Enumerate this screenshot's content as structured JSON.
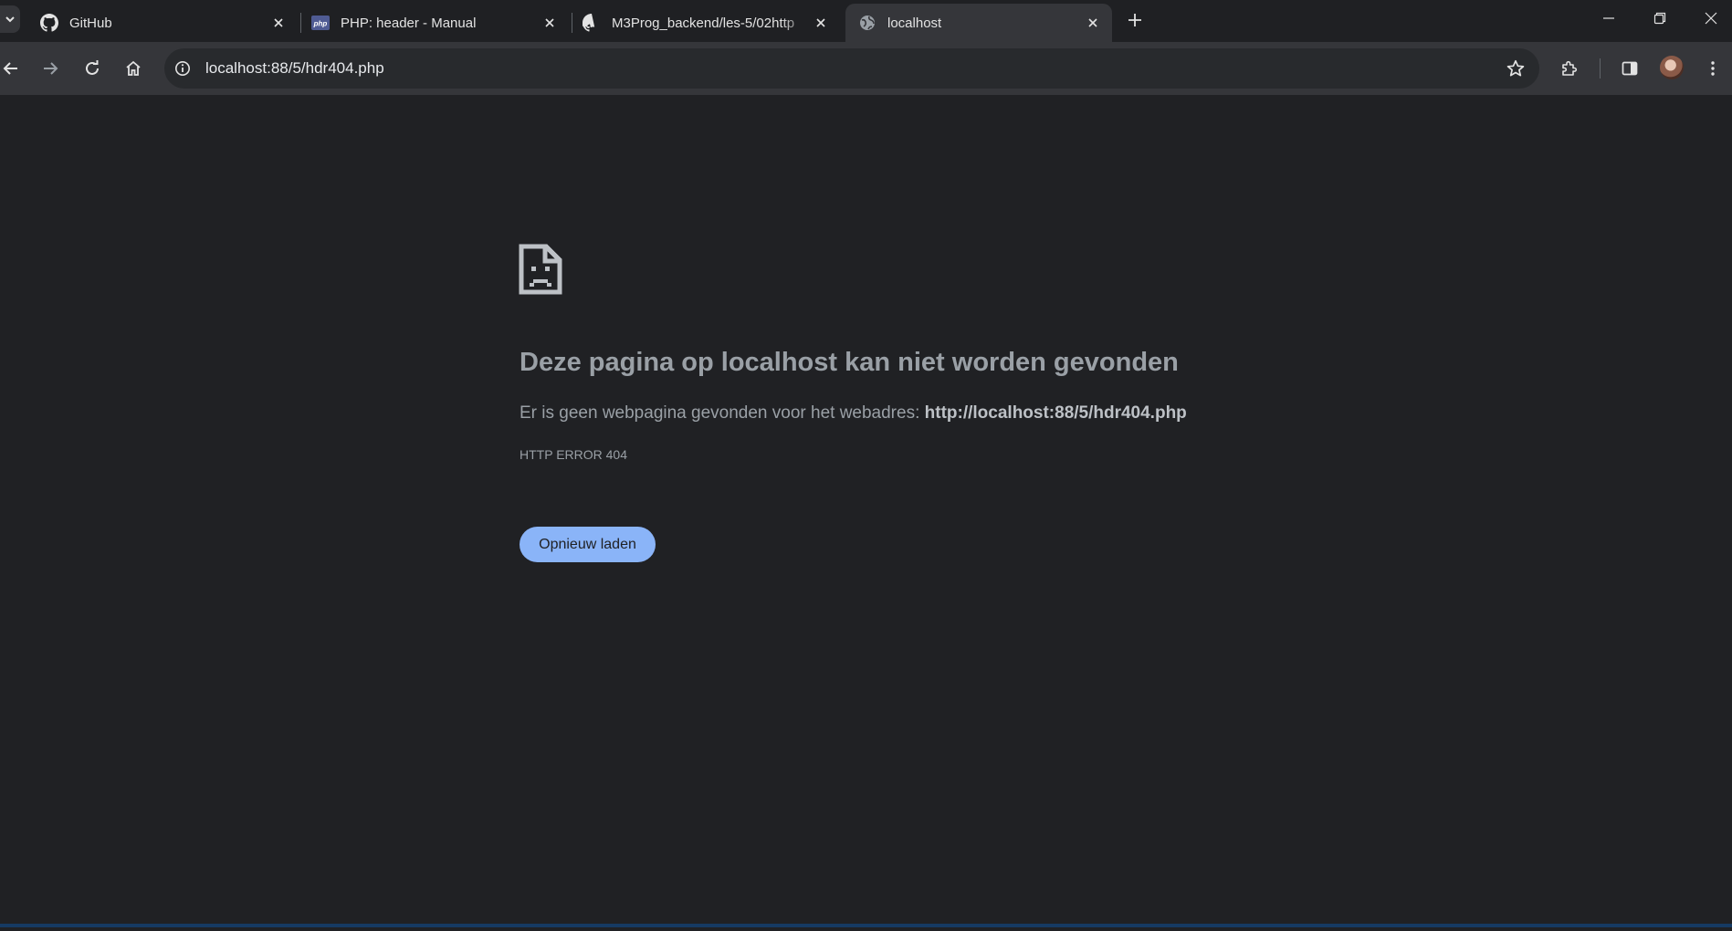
{
  "tabs": [
    {
      "title": "GitHub",
      "favicon": "github-icon",
      "active": false
    },
    {
      "title": "PHP: header - Manual",
      "favicon": "php-icon",
      "favicon_text": "php",
      "active": false
    },
    {
      "title": "M3Prog_backend/les-5/02http",
      "favicon": "github-icon",
      "active": false
    },
    {
      "title": "localhost",
      "favicon": "globe-icon",
      "active": true
    }
  ],
  "address_bar": {
    "url": "localhost:88/5/hdr404.php"
  },
  "error_page": {
    "icon": "sad-document-icon",
    "title": "Deze pagina op localhost kan niet worden gevonden",
    "description_prefix": "Er is geen webpagina gevonden voor het webadres:",
    "url": "http://localhost:88/5/hdr404.php",
    "error_code": "HTTP ERROR 404",
    "reload_label": "Opnieuw laden"
  },
  "colors": {
    "page_background": "#202124",
    "toolbar": "#35363a",
    "accent": "#8ab4f8",
    "text_muted": "#9aa0a6"
  }
}
